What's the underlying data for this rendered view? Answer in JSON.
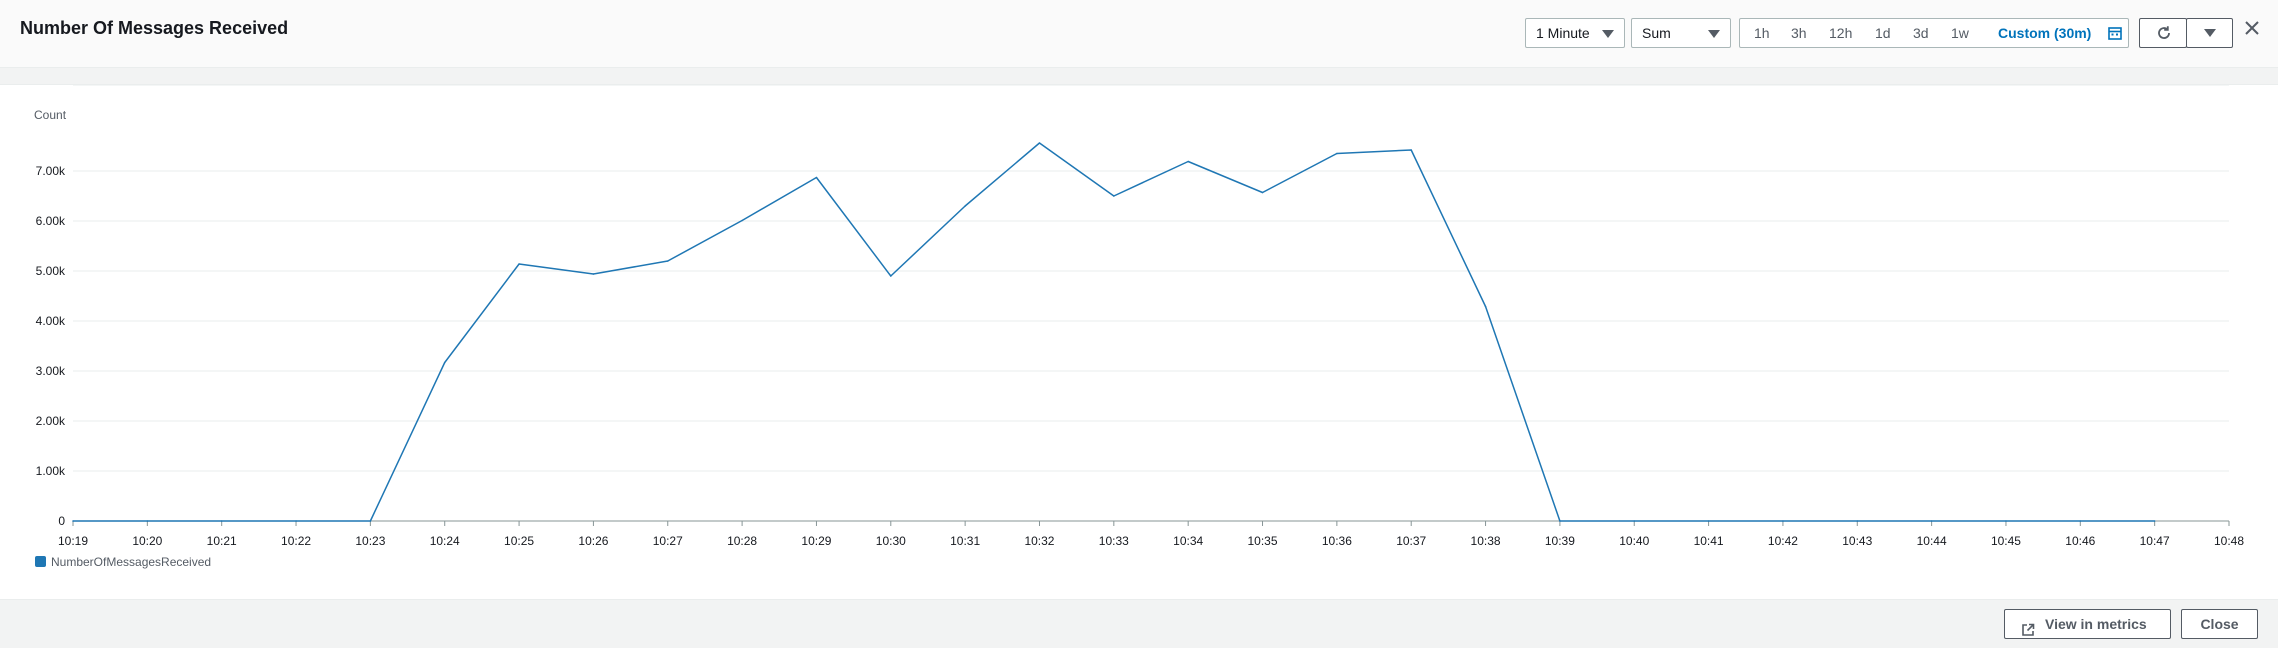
{
  "dialog": {
    "title": "Number Of Messages Received",
    "period": "1 Minute",
    "statistic": "Sum",
    "time_ranges": [
      "1h",
      "3h",
      "12h",
      "1d",
      "3d",
      "1w",
      "Custom (30m)"
    ],
    "active_range": "Custom (30m)",
    "view_in_metrics_label": "View in metrics",
    "close_label": "Close",
    "icons": {
      "period_caret": "caret-down-icon",
      "calendar": "calendar-icon",
      "refresh": "refresh-icon",
      "refresh_options": "caret-down-icon",
      "close": "close-icon",
      "external": "external-link-icon"
    }
  },
  "chart_data": {
    "type": "line",
    "ylabel": "Count",
    "ylim": [
      0,
      8000
    ],
    "yticks": [
      {
        "value": 0,
        "label": "0"
      },
      {
        "value": 1000,
        "label": "1.00k"
      },
      {
        "value": 2000,
        "label": "2.00k"
      },
      {
        "value": 3000,
        "label": "3.00k"
      },
      {
        "value": 4000,
        "label": "4.00k"
      },
      {
        "value": 5000,
        "label": "5.00k"
      },
      {
        "value": 6000,
        "label": "6.00k"
      },
      {
        "value": 7000,
        "label": "7.00k"
      }
    ],
    "x": [
      "10:19",
      "10:20",
      "10:21",
      "10:22",
      "10:23",
      "10:24",
      "10:25",
      "10:26",
      "10:27",
      "10:28",
      "10:29",
      "10:30",
      "10:31",
      "10:32",
      "10:33",
      "10:34",
      "10:35",
      "10:36",
      "10:37",
      "10:38",
      "10:39",
      "10:40",
      "10:41",
      "10:42",
      "10:43",
      "10:44",
      "10:45",
      "10:46",
      "10:47",
      "10:48"
    ],
    "series": [
      {
        "name": "NumberOfMessagesReceived",
        "color": "#1f77b4",
        "values": [
          0,
          0,
          0,
          0,
          0,
          3170,
          5140,
          4940,
          5200,
          6010,
          6870,
          4900,
          6300,
          7560,
          6500,
          7190,
          6570,
          7350,
          7420,
          4290,
          0,
          0,
          0,
          0,
          0,
          0,
          0,
          0,
          0,
          null
        ]
      }
    ],
    "grid": true,
    "legend": "bottom-left"
  }
}
